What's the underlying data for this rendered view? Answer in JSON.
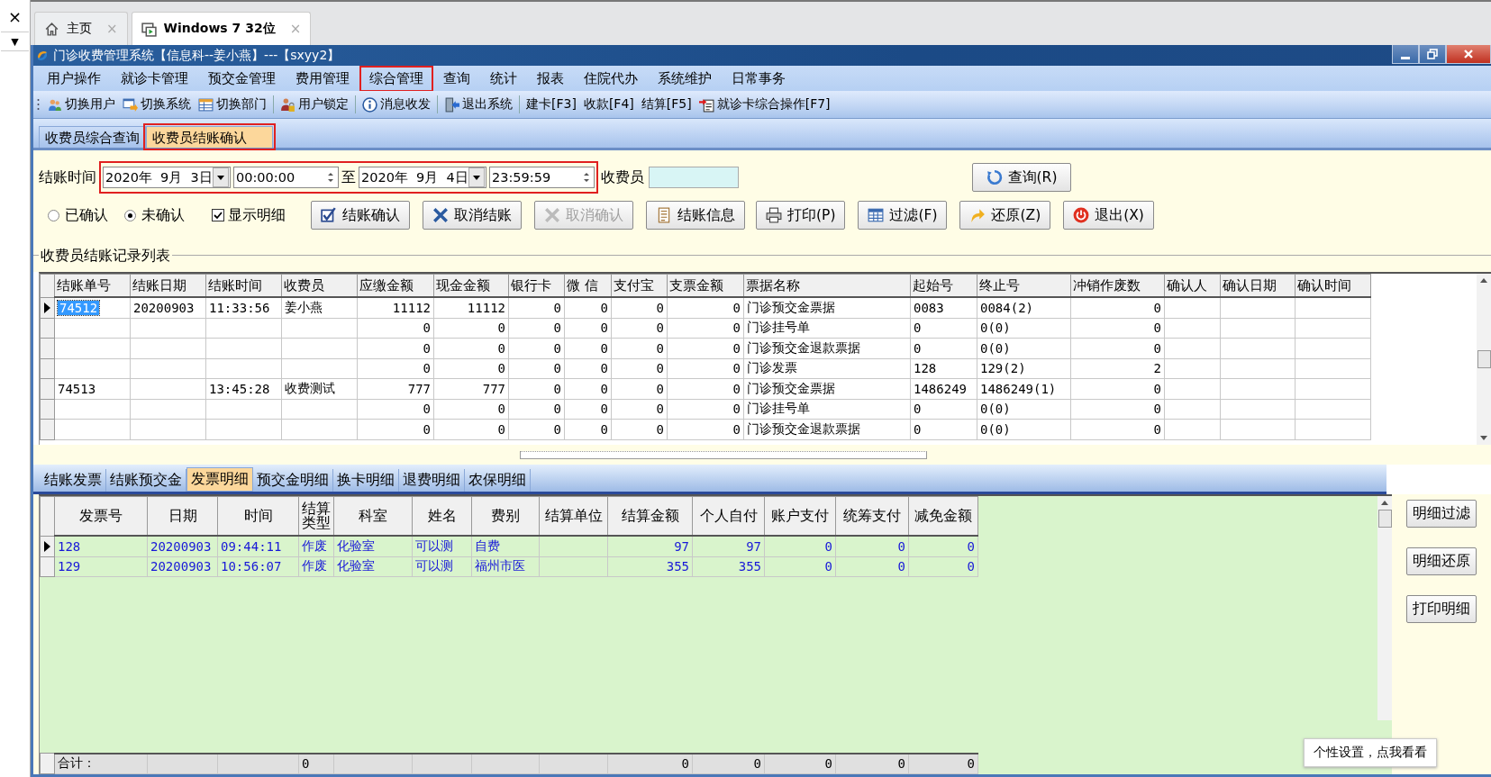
{
  "browser": {
    "close_glyph": "×",
    "dropdown_glyph": "▼",
    "tabs": [
      {
        "label": "主页",
        "selected": false,
        "close": "×"
      },
      {
        "label": "Windows 7 32位",
        "selected": true,
        "close": "×"
      }
    ]
  },
  "window": {
    "title": "门诊收费管理系统【信息科--姜小燕】---【sxyy2】"
  },
  "menu": [
    {
      "label": "用户操作",
      "highlighted": false
    },
    {
      "label": "就诊卡管理",
      "highlighted": false
    },
    {
      "label": "预交金管理",
      "highlighted": false
    },
    {
      "label": "费用管理",
      "highlighted": false
    },
    {
      "label": "综合管理",
      "highlighted": true
    },
    {
      "label": "查询",
      "highlighted": false
    },
    {
      "label": "统计",
      "highlighted": false
    },
    {
      "label": "报表",
      "highlighted": false
    },
    {
      "label": "住院代办",
      "highlighted": false
    },
    {
      "label": "系统维护",
      "highlighted": false
    },
    {
      "label": "日常事务",
      "highlighted": false
    }
  ],
  "toolbar": [
    [
      {
        "label": "切换用户",
        "kind": "users"
      },
      {
        "label": "切换系统",
        "kind": "switch"
      },
      {
        "label": "切换部门",
        "kind": "dept"
      }
    ],
    [
      {
        "label": "用户锁定",
        "kind": "lock"
      }
    ],
    [
      {
        "label": "消息收发",
        "kind": "info"
      }
    ],
    [
      {
        "label": "退出系统",
        "kind": "exit"
      }
    ],
    [
      {
        "label": "建卡[F3]",
        "kind": "text"
      },
      {
        "label": "收款[F4]",
        "kind": "text"
      },
      {
        "label": "结算[F5]",
        "kind": "text"
      },
      {
        "label": "就诊卡综合操作[F7]",
        "kind": "card"
      }
    ]
  ],
  "tabs": [
    {
      "label": "收费员综合查询",
      "selected": false,
      "highlighted": false
    },
    {
      "label": "收费员结账确认",
      "selected": true,
      "highlighted": true
    }
  ],
  "filter": {
    "label": "结账时间",
    "highlighted": true,
    "from_date": "2020年  9月  3日",
    "from_time": "00:00:00",
    "to_label": "至",
    "to_date": "2020年  9月  4日",
    "to_time": "23:59:59",
    "cashier_label": "收费员",
    "query_button": "查询(R)"
  },
  "options": {
    "radios": [
      {
        "label": "已确认",
        "selected": false
      },
      {
        "label": "未确认",
        "selected": true
      }
    ],
    "checkbox": {
      "label": "显示明细",
      "checked": true
    }
  },
  "buttons": [
    {
      "label": "结账确认",
      "kind": "check",
      "disabled": false
    },
    {
      "label": "取消结账",
      "kind": "cancel",
      "disabled": false
    },
    {
      "label": "取消确认",
      "kind": "cancel",
      "disabled": true
    },
    {
      "label": "结账信息",
      "kind": "doc",
      "disabled": false
    },
    {
      "label": "打印(P)",
      "kind": "print",
      "disabled": false
    },
    {
      "label": "过滤(F)",
      "kind": "filter",
      "disabled": false
    },
    {
      "label": "还原(Z)",
      "kind": "undo",
      "disabled": false
    },
    {
      "label": "退出(X)",
      "kind": "power",
      "disabled": false
    }
  ],
  "records": {
    "title": "收费员结账记录列表",
    "columns": [
      {
        "label": "结账单号"
      },
      {
        "label": "结账日期"
      },
      {
        "label": "结账时间"
      },
      {
        "label": "收费员"
      },
      {
        "label": "应缴金额"
      },
      {
        "label": "现金金额"
      },
      {
        "label": "银行卡"
      },
      {
        "label": "微  信"
      },
      {
        "label": "支付宝"
      },
      {
        "label": "支票金额"
      },
      {
        "label": "票据名称"
      },
      {
        "label": "起始号"
      },
      {
        "label": "终止号"
      },
      {
        "label": "冲销作废数"
      },
      {
        "label": "确认人"
      },
      {
        "label": "确认日期"
      },
      {
        "label": "确认时间"
      }
    ],
    "rows": [
      {
        "selected": true,
        "cells": [
          "74512",
          "20200903",
          "11:33:56",
          "姜小燕",
          "11112",
          "11112",
          "0",
          "0",
          "0",
          "0",
          "门诊预交金票据",
          "0083",
          "0084(2)",
          "0"
        ]
      },
      {
        "selected": false,
        "cells": [
          null,
          null,
          null,
          null,
          "0",
          "0",
          "0",
          "0",
          "0",
          "0",
          "门诊挂号单",
          "0",
          "0(0)",
          "0"
        ]
      },
      {
        "selected": false,
        "cells": [
          null,
          null,
          null,
          null,
          "0",
          "0",
          "0",
          "0",
          "0",
          "0",
          "门诊预交金退款票据",
          "0",
          "0(0)",
          "0"
        ]
      },
      {
        "selected": false,
        "cells": [
          null,
          null,
          null,
          null,
          "0",
          "0",
          "0",
          "0",
          "0",
          "0",
          "门诊发票",
          "128",
          "129(2)",
          "2"
        ]
      },
      {
        "selected": false,
        "cells": [
          "74513",
          null,
          "13:45:28",
          "收费测试",
          "777",
          "777",
          "0",
          "0",
          "0",
          "0",
          "门诊预交金票据",
          "1486249",
          "1486249(1)",
          "0"
        ]
      },
      {
        "selected": false,
        "cells": [
          null,
          null,
          null,
          null,
          "0",
          "0",
          "0",
          "0",
          "0",
          "0",
          "门诊挂号单",
          "0",
          "0(0)",
          "0"
        ]
      },
      {
        "selected": false,
        "cells": [
          null,
          null,
          null,
          null,
          "0",
          "0",
          "0",
          "0",
          "0",
          "0",
          "门诊预交金退款票据",
          "0",
          "0(0)",
          "0"
        ]
      }
    ]
  },
  "detail_tabs": [
    {
      "label": "结账发票",
      "selected": false
    },
    {
      "label": "结账预交金",
      "selected": false
    },
    {
      "label": "发票明细",
      "selected": true
    },
    {
      "label": "预交金明细",
      "selected": false
    },
    {
      "label": "换卡明细",
      "selected": false
    },
    {
      "label": "退费明细",
      "selected": false
    },
    {
      "label": "农保明细",
      "selected": false
    }
  ],
  "details": {
    "columns": [
      {
        "label": "发票号"
      },
      {
        "label": "日期"
      },
      {
        "label": "时间"
      },
      {
        "label": "结算类型",
        "total": "0"
      },
      {
        "label": "科室"
      },
      {
        "label": "姓名"
      },
      {
        "label": "费别"
      },
      {
        "label": "结算单位"
      },
      {
        "label": "结算金额",
        "total": "0"
      },
      {
        "label": "个人自付",
        "total": "0"
      },
      {
        "label": "账户支付",
        "total": "0"
      },
      {
        "label": "统筹支付",
        "total": "0"
      },
      {
        "label": "减免金额",
        "total": "0"
      }
    ],
    "rows": [
      {
        "selected": true,
        "cells": [
          "128",
          "20200903",
          "09:44:11",
          "作废",
          "化验室",
          "可以测",
          "自费",
          null,
          "97",
          "97",
          "0",
          "0",
          "0"
        ]
      },
      {
        "selected": false,
        "cells": [
          "129",
          "20200903",
          "10:56:07",
          "作废",
          "化验室",
          "可以测",
          "福州市医",
          null,
          "355",
          "355",
          "0",
          "0",
          "0"
        ]
      }
    ],
    "total_label": "合计："
  },
  "side_buttons": [
    "明细过滤",
    "明细还原",
    "打印明细"
  ],
  "tooltip": "个性设置，点我看看"
}
